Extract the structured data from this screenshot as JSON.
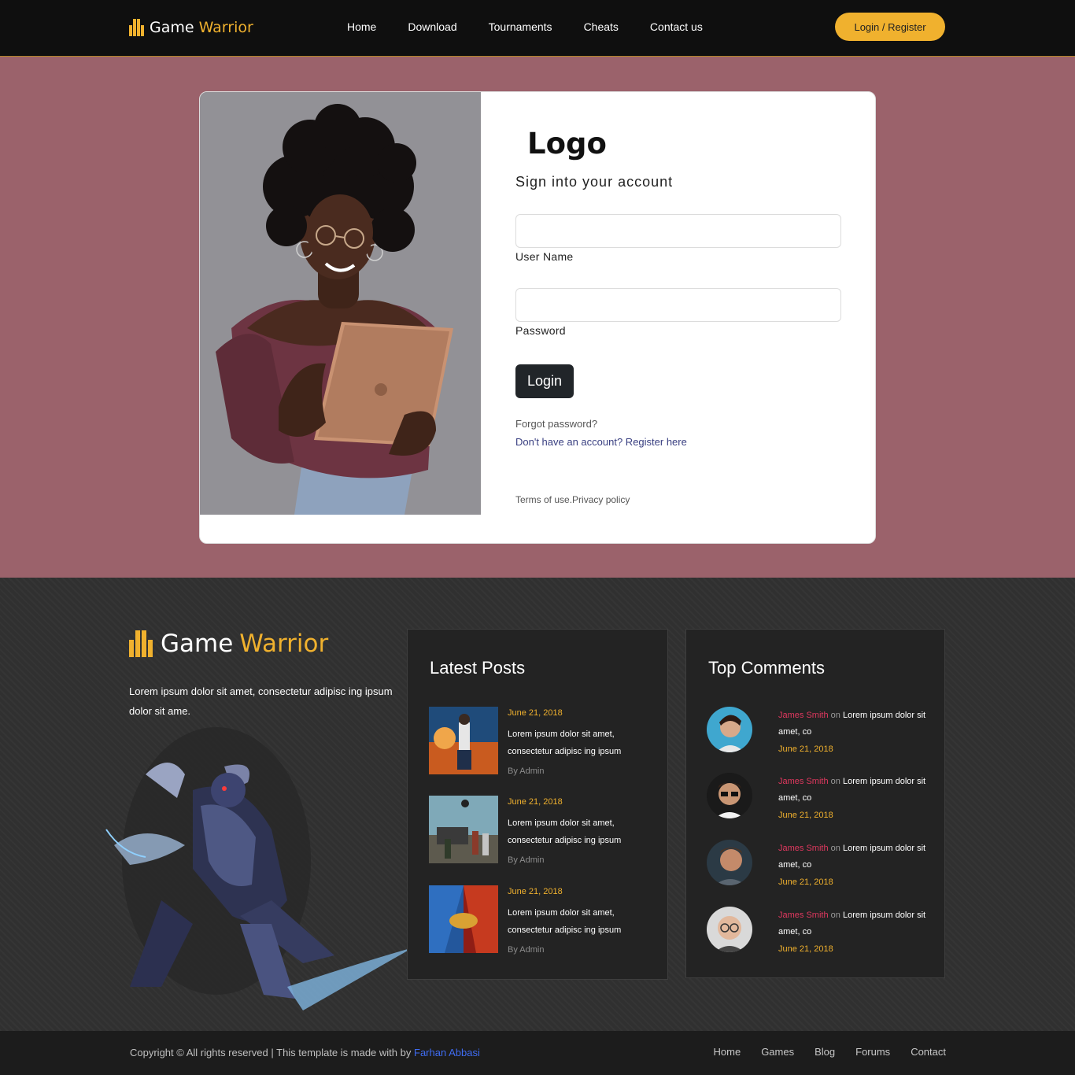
{
  "header": {
    "brand_word1": "Game",
    "brand_word2": "Warrior",
    "nav": [
      "Home",
      "Download",
      "Tournaments",
      "Cheats",
      "Contact us"
    ],
    "login_button": "Login / Register"
  },
  "login_card": {
    "logo": "Logo",
    "subtitle": "Sign into your account",
    "username_label": "User Name",
    "password_label": "Password",
    "submit_label": "Login",
    "forgot": "Forgot password?",
    "register": "Don't have an account? Register here",
    "terms": "Terms of use.Privacy policy"
  },
  "footer": {
    "brand_word1": "Game",
    "brand_word2": "Warrior",
    "description": "Lorem ipsum dolor sit amet, consectetur adipisc ing ipsum dolor sit ame.",
    "latest_posts": {
      "title": "Latest Posts",
      "items": [
        {
          "date": "June 21, 2018",
          "text": "Lorem ipsum dolor sit amet, consectetur adipisc ing ipsum",
          "by": "By Admin"
        },
        {
          "date": "June 21, 2018",
          "text": "Lorem ipsum dolor sit amet, consectetur adipisc ing ipsum",
          "by": "By Admin"
        },
        {
          "date": "June 21, 2018",
          "text": "Lorem ipsum dolor sit amet, consectetur adipisc ing ipsum",
          "by": "By Admin"
        }
      ]
    },
    "top_comments": {
      "title": "Top Comments",
      "items": [
        {
          "name": "James Smith",
          "on": "on",
          "text": "Lorem ipsum dolor sit amet, co",
          "date": "June 21, 2018"
        },
        {
          "name": "James Smith",
          "on": "on",
          "text": "Lorem ipsum dolor sit amet, co",
          "date": "June 21, 2018"
        },
        {
          "name": "James Smith",
          "on": "on",
          "text": "Lorem ipsum dolor sit amet, co",
          "date": "June 21, 2018"
        },
        {
          "name": "James Smith",
          "on": "on",
          "text": "Lorem ipsum dolor sit amet, co",
          "date": "June 21, 2018"
        }
      ]
    }
  },
  "bottom": {
    "copyright": "Copyright © All rights reserved | This template is made with by",
    "author": "Farhan Abbasi",
    "nav": [
      "Home",
      "Games",
      "Blog",
      "Forums",
      "Contact"
    ]
  },
  "colors": {
    "accent": "#f0b12e",
    "page_background": "#9b626b",
    "header_background": "#0f0f0f",
    "footer_background": "#303030",
    "comment_name": "#e0385f",
    "link_blue": "#3f6cf2"
  }
}
